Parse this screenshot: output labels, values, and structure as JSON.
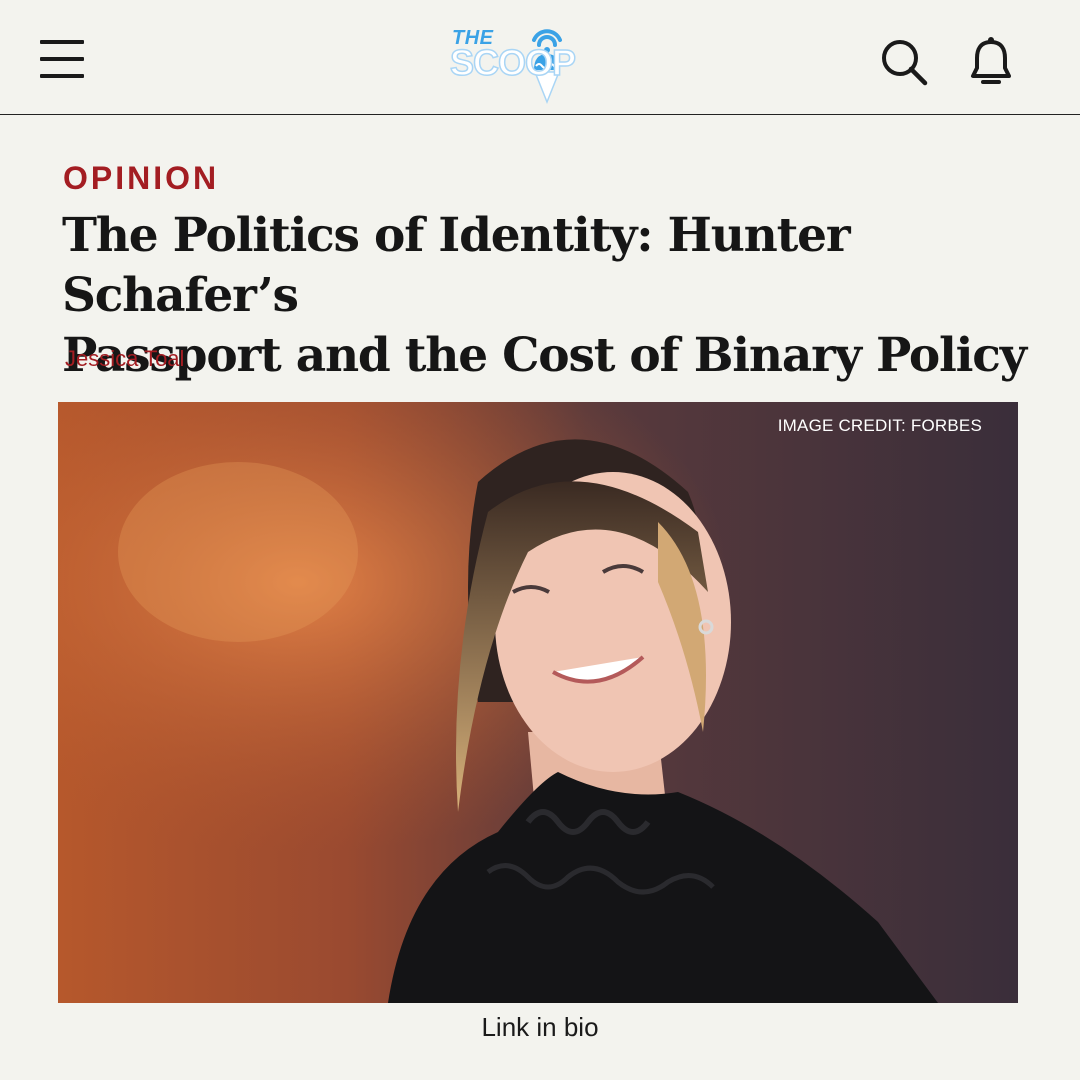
{
  "header": {
    "logo_top": "THE",
    "logo_main": "SCOOP",
    "menu_icon": "hamburger-menu-icon",
    "search_icon": "search-icon",
    "notifications_icon": "bell-icon",
    "logo_color": "#3aa2e6"
  },
  "article": {
    "kicker": "OPINION",
    "headline_line1": "The Politics of Identity: Hunter Schafer’s",
    "headline_line2": "Passport and the Cost of Binary Policy",
    "author": "Jessica Toal",
    "image_credit": "IMAGE CREDIT: FORBES",
    "caption": "Link in bio",
    "accent_color": "#a31d22"
  }
}
